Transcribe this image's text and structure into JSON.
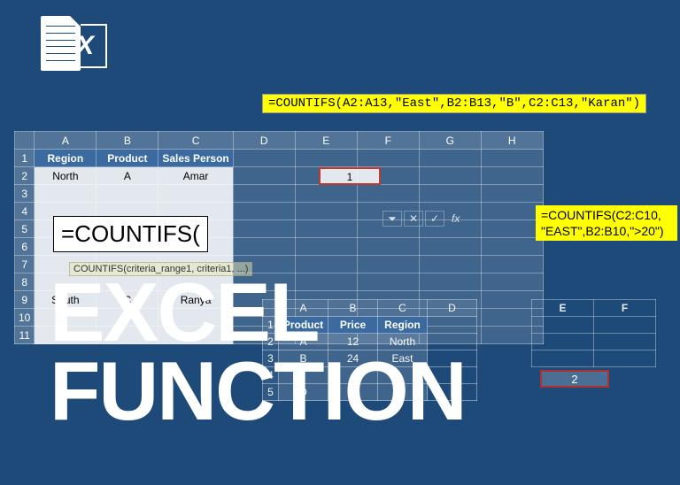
{
  "logo": {
    "letter": "X"
  },
  "formula1": "=COUNTIFS(A2:A13,\"East\",B2:B13,\"B\",C2:C13,\"Karan\")",
  "sheet1": {
    "cols": [
      "A",
      "B",
      "C",
      "D",
      "E",
      "F",
      "G",
      "H"
    ],
    "headers": [
      "Region",
      "Product",
      "Sales Person"
    ],
    "rows": [
      [
        "North",
        "A",
        "Amar"
      ],
      [
        "",
        "",
        ""
      ],
      [
        "",
        "",
        ""
      ],
      [
        "",
        "",
        ""
      ],
      [
        "",
        "",
        ""
      ],
      [
        "",
        "",
        ""
      ],
      [
        "",
        "",
        ""
      ],
      [
        "South",
        "C",
        "Ranya"
      ],
      [
        "",
        "",
        ""
      ],
      [
        "",
        "",
        ""
      ]
    ],
    "result": "1"
  },
  "countifs_box": "=COUNTIFS(",
  "tooltip": "COUNTIFS(criteria_range1, criteria1, ...)",
  "big_title_line1": "EXCEL",
  "big_title_line2": "FUNCTION",
  "formula_bar": {
    "down": "⏷",
    "cancel": "✕",
    "confirm": "✓",
    "fx": "fx"
  },
  "formula2_line1": "=COUNTIFS(C2:C10,",
  "formula2_line2": "\"EAST\",B2:B10,\">20\")",
  "sheet2": {
    "cols": [
      "A",
      "B",
      "C",
      "D"
    ],
    "cols_right": [
      "E",
      "F"
    ],
    "headers": [
      "Product",
      "Price",
      "Region"
    ],
    "rows": [
      [
        "A",
        "12",
        "North"
      ],
      [
        "B",
        "24",
        "East"
      ],
      [
        "",
        "",
        ""
      ],
      [
        "D",
        "9",
        ""
      ]
    ],
    "result": "2"
  }
}
